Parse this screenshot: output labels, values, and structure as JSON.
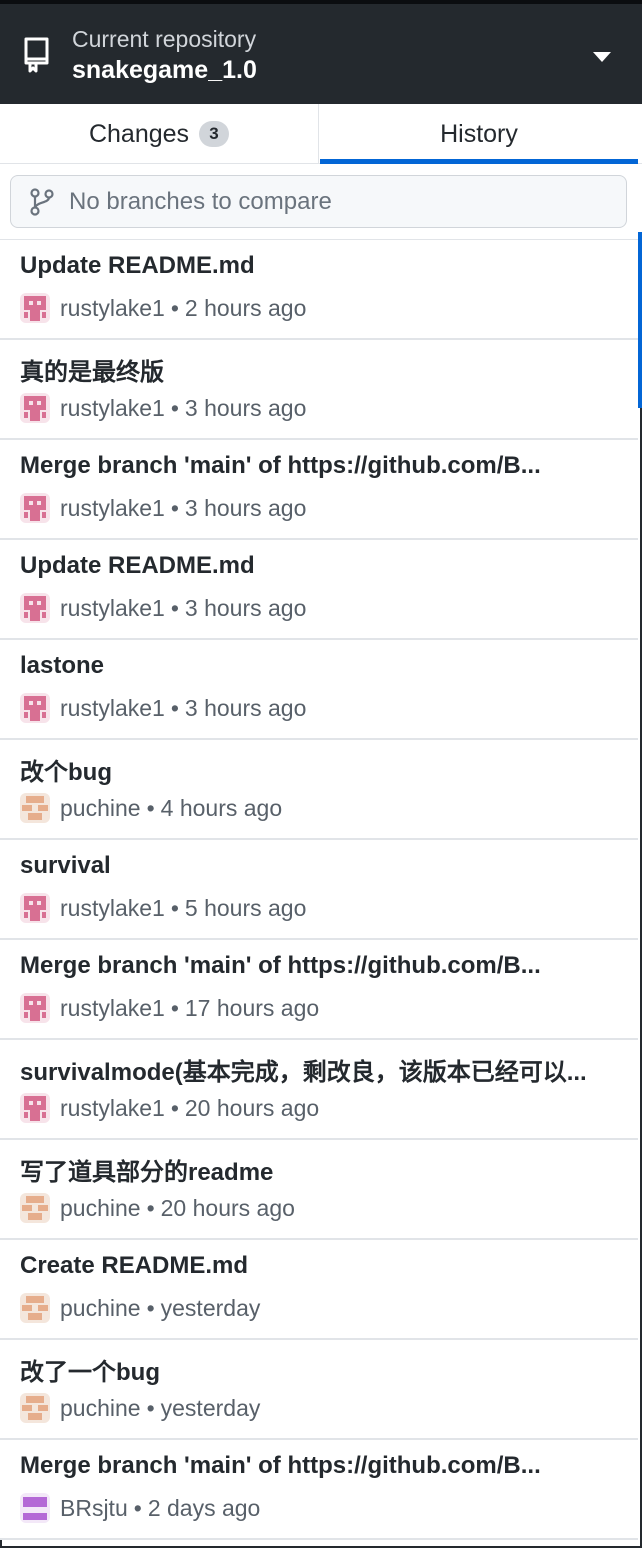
{
  "header": {
    "caption": "Current repository",
    "repo_name": "snakegame_1.0",
    "icons": {
      "repo": "repo-icon",
      "caret": "chevron-down-icon"
    }
  },
  "tabs": [
    {
      "label": "Changes",
      "badge": "3",
      "selected": false
    },
    {
      "label": "History",
      "selected": true
    }
  ],
  "compare": {
    "placeholder": "No branches to compare",
    "icon": "git-branch-icon"
  },
  "colors": {
    "header_bg": "#24292e",
    "accent": "#0366d6",
    "avatar_rustylake1": "#d87093",
    "avatar_puchine": "#e6ad8c",
    "avatar_brsjtu": "#b469d6"
  },
  "commits": [
    {
      "summary": "Update README.md",
      "author": "rustylake1",
      "time": "2 hours ago",
      "avatar": "rustylake1"
    },
    {
      "summary": "真的是最终版",
      "author": "rustylake1",
      "time": "3 hours ago",
      "avatar": "rustylake1"
    },
    {
      "summary": "Merge branch 'main' of https://github.com/B...",
      "author": "rustylake1",
      "time": "3 hours ago",
      "avatar": "rustylake1"
    },
    {
      "summary": "Update README.md",
      "author": "rustylake1",
      "time": "3 hours ago",
      "avatar": "rustylake1"
    },
    {
      "summary": "lastone",
      "author": "rustylake1",
      "time": "3 hours ago",
      "avatar": "rustylake1"
    },
    {
      "summary": "改个bug",
      "author": "puchine",
      "time": "4 hours ago",
      "avatar": "puchine"
    },
    {
      "summary": "survival",
      "author": "rustylake1",
      "time": "5 hours ago",
      "avatar": "rustylake1"
    },
    {
      "summary": "Merge branch 'main' of https://github.com/B...",
      "author": "rustylake1",
      "time": "17 hours ago",
      "avatar": "rustylake1"
    },
    {
      "summary": "survivalmode(基本完成，剩改良，该版本已经可以...",
      "author": "rustylake1",
      "time": "20 hours ago",
      "avatar": "rustylake1"
    },
    {
      "summary": "写了道具部分的readme",
      "author": "puchine",
      "time": "20 hours ago",
      "avatar": "puchine"
    },
    {
      "summary": "Create README.md",
      "author": "puchine",
      "time": "yesterday",
      "avatar": "puchine"
    },
    {
      "summary": "改了一个bug",
      "author": "puchine",
      "time": "yesterday",
      "avatar": "puchine"
    },
    {
      "summary": "Merge branch 'main' of https://github.com/B...",
      "author": "BRsjtu",
      "time": "2 days ago",
      "avatar": "brsjtu"
    }
  ]
}
